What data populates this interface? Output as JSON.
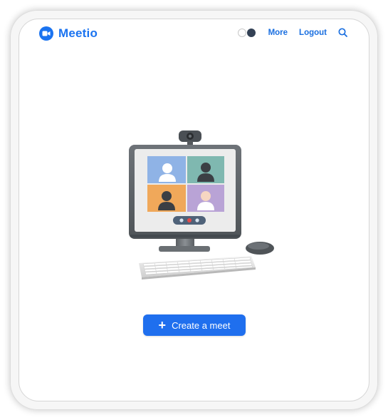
{
  "brand": {
    "name": "Meetio",
    "icon": "video-camera-icon",
    "color": "#1a73f0"
  },
  "nav": {
    "theme_toggle": {
      "options": [
        "light",
        "dark"
      ],
      "colors": [
        "#ffffff",
        "#334155"
      ]
    },
    "more_label": "More",
    "logout_label": "Logout",
    "search_icon": "search-icon"
  },
  "hero": {
    "illustration": "desktop-video-conference-illustration",
    "participant_tile_colors": [
      "#8fb3e6",
      "#7fb8b0",
      "#f0a85a",
      "#b9a3d6"
    ]
  },
  "actions": {
    "create_meet_label": "Create a meet",
    "create_meet_icon": "plus-icon",
    "button_color": "#1f6fee"
  }
}
